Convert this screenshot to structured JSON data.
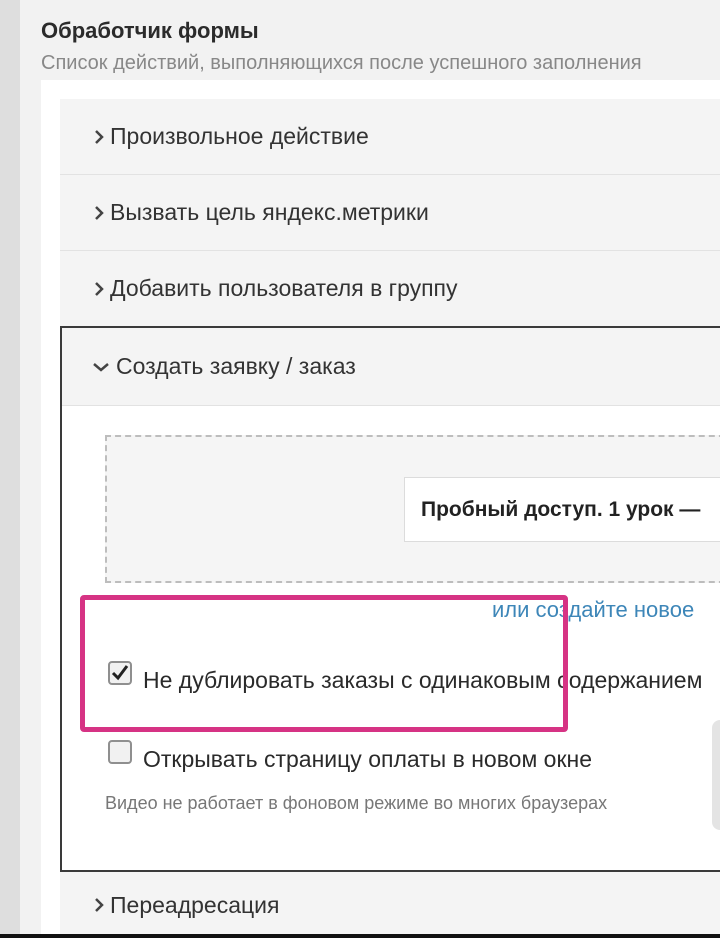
{
  "form_handler": {
    "title": "Обработчик формы",
    "subtitle": "Список действий, выполняющихся после успешного заполнения"
  },
  "actions": [
    {
      "label": "Произвольное действие",
      "icon": "chevron-right-icon"
    },
    {
      "label": "Вызвать цель яндекс.метрики",
      "icon": "chevron-right-icon"
    },
    {
      "label": "Добавить пользователя в группу",
      "icon": "chevron-right-icon"
    }
  ],
  "expanded_action": {
    "label": "Создать заявку / заказ",
    "icon": "chevron-down-icon",
    "product": "Пробный доступ. 1 урок —",
    "create_link": "или создайте новое",
    "options": [
      {
        "label": "Не дублировать заказы с одинаковым содержанием",
        "checked": true
      },
      {
        "label": "Открывать страницу оплаты в новом окне",
        "checked": false
      }
    ],
    "hint": "Видео не работает в фоновом режиме во многих браузерах"
  },
  "redirect_action": {
    "label": "Переадресация",
    "icon": "chevron-right-icon"
  },
  "colors": {
    "highlight": "#d63384",
    "link": "#3d86b8",
    "panel_bg": "#f4f4f4"
  }
}
